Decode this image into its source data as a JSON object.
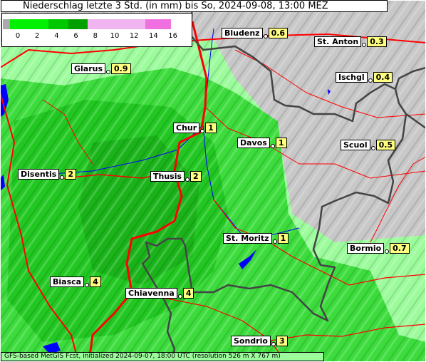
{
  "title": "Niederschlag letzte 3 Std. (in mm) bis So, 2024-09-08, 13:00 MEZ",
  "legend": {
    "ticks": [
      "0",
      "2",
      "4",
      "6",
      "8",
      "10",
      "12",
      "14",
      "16"
    ],
    "colors": [
      "#aaaaaa",
      "#00f000",
      "#00c800",
      "#00a000",
      "#f0b4f0",
      "#f070e0"
    ]
  },
  "cities": [
    {
      "name": "Bludenz",
      "value": "0.6"
    },
    {
      "name": "St. Anton",
      "value": "0.3"
    },
    {
      "name": "Glarus",
      "value": "0.9"
    },
    {
      "name": "Ischgl",
      "value": "0.4"
    },
    {
      "name": "Chur",
      "value": "1"
    },
    {
      "name": "Davos",
      "value": "1"
    },
    {
      "name": "Scuol",
      "value": "0.5"
    },
    {
      "name": "Disentis",
      "value": "2"
    },
    {
      "name": "Thusis",
      "value": "2"
    },
    {
      "name": "St. Moritz",
      "value": "1"
    },
    {
      "name": "Bormio",
      "value": "0.7"
    },
    {
      "name": "Biasca",
      "value": "4"
    },
    {
      "name": "Chiavenna",
      "value": "4"
    },
    {
      "name": "Sondrio",
      "value": "3"
    }
  ],
  "footer": "GFS-based MetGIS Fcst, initialized 2024-09-07, 18:00 UTC  (resolution 526 m X 767 m)",
  "colors": {
    "land": "#c8c8c8",
    "precip_light": "#9cfc9c",
    "precip_mid": "#3cdc3c",
    "road": "#ff0000",
    "border": "#444444",
    "lake": "#0000ff",
    "value_box": "#ffff80"
  }
}
